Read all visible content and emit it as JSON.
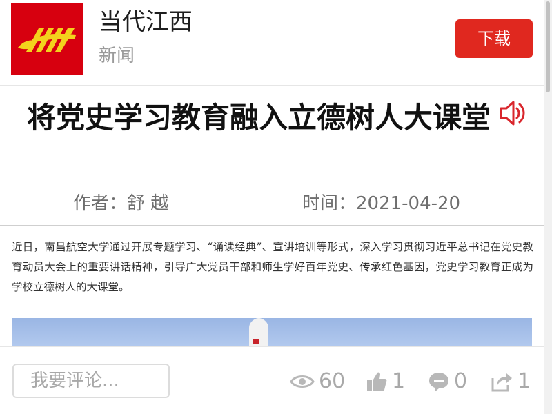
{
  "header": {
    "app_name": "当代江西",
    "category": "新闻",
    "download_label": "下载",
    "logo_icon": "jiangxi-logo-icon"
  },
  "article": {
    "title": "将党史学习教育融入立德树人大课堂",
    "author_label": "作者：舒 越",
    "time_label": "时间：2021-04-20",
    "lead": "近日，南昌航空大学通过开展专题学习、“诵读经典”、宣讲培训等形式，深入学习贯彻习近平总书记在党史教育动员大会上的重要讲话精神，引导广大党员干部和师生学好百年党史、传承红色基因，党史学习教育正成为学校立德树人的大课堂。",
    "audio_icon": "speaker-icon"
  },
  "bottom_bar": {
    "comment_placeholder": "我要评论...",
    "views": "60",
    "likes": "1",
    "comments": "0",
    "shares": "1",
    "icons": [
      "eye-icon",
      "thumbs-up-icon",
      "comment-bubble-icon",
      "share-icon"
    ]
  },
  "colors": {
    "brand_red": "#e0281f",
    "logo_red": "#d7000f",
    "logo_yellow": "#f3d21d",
    "muted_gray": "#a9a9a9"
  }
}
